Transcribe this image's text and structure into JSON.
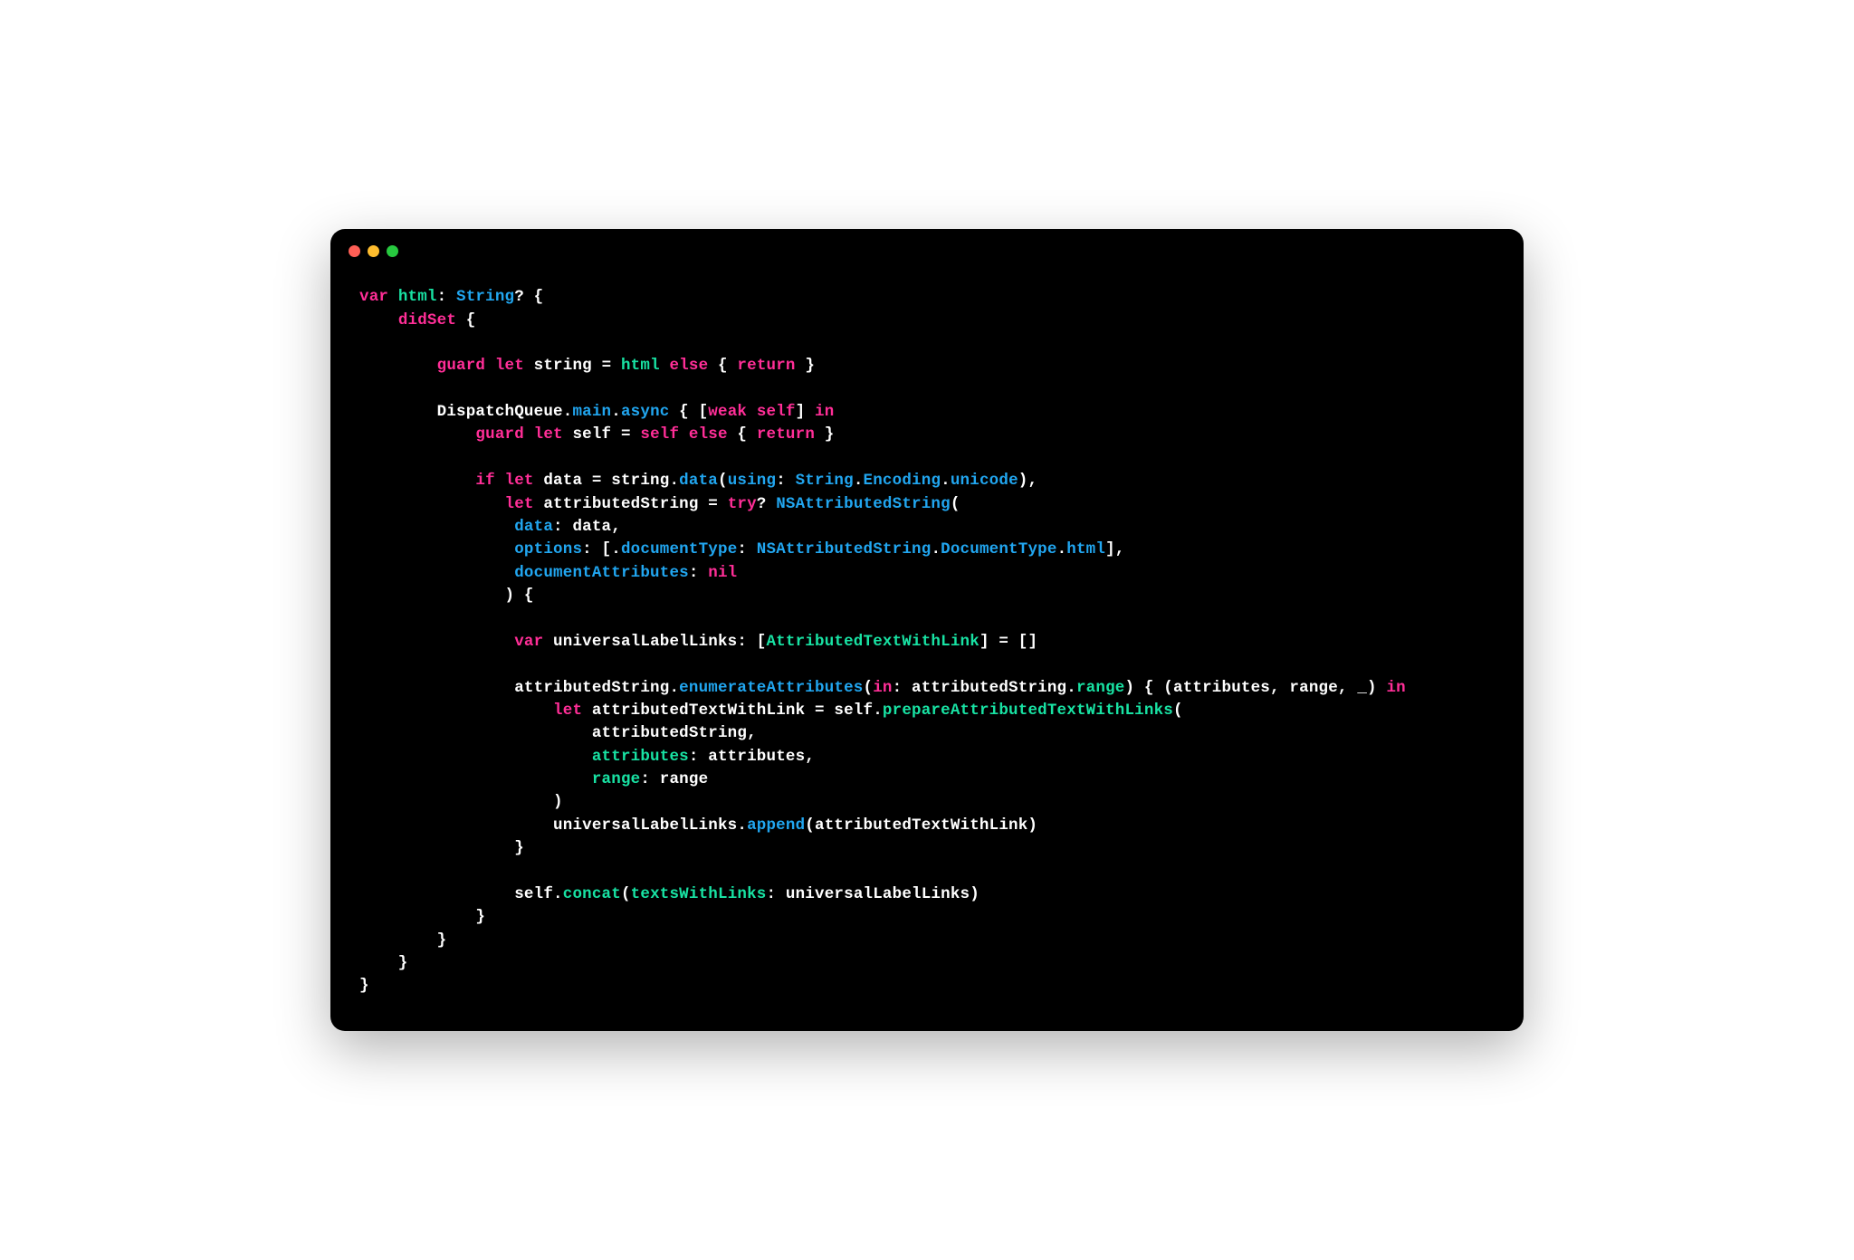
{
  "window": {
    "traffic_lights": [
      "red",
      "yellow",
      "green"
    ]
  },
  "code": {
    "tokens": [
      [
        {
          "t": "var",
          "c": "tok-keyword-pink"
        },
        {
          "t": " ",
          "c": "tok-white"
        },
        {
          "t": "html",
          "c": "tok-method-green"
        },
        {
          "t": ": ",
          "c": "tok-white"
        },
        {
          "t": "String",
          "c": "tok-keyword-blue"
        },
        {
          "t": "? {",
          "c": "tok-white"
        }
      ],
      [
        {
          "t": "    ",
          "c": "tok-white"
        },
        {
          "t": "didSet",
          "c": "tok-keyword-pink"
        },
        {
          "t": " {",
          "c": "tok-white"
        }
      ],
      [
        {
          "t": "",
          "c": "tok-white"
        }
      ],
      [
        {
          "t": "        ",
          "c": "tok-white"
        },
        {
          "t": "guard",
          "c": "tok-keyword-pink"
        },
        {
          "t": " ",
          "c": "tok-white"
        },
        {
          "t": "let",
          "c": "tok-keyword-pink"
        },
        {
          "t": " string = ",
          "c": "tok-white"
        },
        {
          "t": "html",
          "c": "tok-method-green"
        },
        {
          "t": " ",
          "c": "tok-white"
        },
        {
          "t": "else",
          "c": "tok-keyword-pink"
        },
        {
          "t": " { ",
          "c": "tok-white"
        },
        {
          "t": "return",
          "c": "tok-keyword-pink"
        },
        {
          "t": " }",
          "c": "tok-white"
        }
      ],
      [
        {
          "t": "",
          "c": "tok-white"
        }
      ],
      [
        {
          "t": "        DispatchQueue.",
          "c": "tok-white"
        },
        {
          "t": "main",
          "c": "tok-keyword-blue"
        },
        {
          "t": ".",
          "c": "tok-white"
        },
        {
          "t": "async",
          "c": "tok-keyword-blue"
        },
        {
          "t": " { [",
          "c": "tok-white"
        },
        {
          "t": "weak",
          "c": "tok-keyword-pink"
        },
        {
          "t": " ",
          "c": "tok-white"
        },
        {
          "t": "self",
          "c": "tok-keyword-pink"
        },
        {
          "t": "] ",
          "c": "tok-white"
        },
        {
          "t": "in",
          "c": "tok-keyword-pink"
        }
      ],
      [
        {
          "t": "            ",
          "c": "tok-white"
        },
        {
          "t": "guard",
          "c": "tok-keyword-pink"
        },
        {
          "t": " ",
          "c": "tok-white"
        },
        {
          "t": "let",
          "c": "tok-keyword-pink"
        },
        {
          "t": " self = ",
          "c": "tok-white"
        },
        {
          "t": "self",
          "c": "tok-keyword-pink"
        },
        {
          "t": " ",
          "c": "tok-white"
        },
        {
          "t": "else",
          "c": "tok-keyword-pink"
        },
        {
          "t": " { ",
          "c": "tok-white"
        },
        {
          "t": "return",
          "c": "tok-keyword-pink"
        },
        {
          "t": " }",
          "c": "tok-white"
        }
      ],
      [
        {
          "t": "",
          "c": "tok-white"
        }
      ],
      [
        {
          "t": "            ",
          "c": "tok-white"
        },
        {
          "t": "if",
          "c": "tok-keyword-pink"
        },
        {
          "t": " ",
          "c": "tok-white"
        },
        {
          "t": "let",
          "c": "tok-keyword-pink"
        },
        {
          "t": " data = string.",
          "c": "tok-white"
        },
        {
          "t": "data",
          "c": "tok-keyword-blue"
        },
        {
          "t": "(",
          "c": "tok-white"
        },
        {
          "t": "using",
          "c": "tok-keyword-blue"
        },
        {
          "t": ": ",
          "c": "tok-white"
        },
        {
          "t": "String",
          "c": "tok-keyword-blue"
        },
        {
          "t": ".",
          "c": "tok-white"
        },
        {
          "t": "Encoding",
          "c": "tok-keyword-blue"
        },
        {
          "t": ".",
          "c": "tok-white"
        },
        {
          "t": "unicode",
          "c": "tok-keyword-blue"
        },
        {
          "t": "),",
          "c": "tok-white"
        }
      ],
      [
        {
          "t": "               ",
          "c": "tok-white"
        },
        {
          "t": "let",
          "c": "tok-keyword-pink"
        },
        {
          "t": " attributedString = ",
          "c": "tok-white"
        },
        {
          "t": "try",
          "c": "tok-keyword-pink"
        },
        {
          "t": "? ",
          "c": "tok-white"
        },
        {
          "t": "NSAttributedString",
          "c": "tok-keyword-blue"
        },
        {
          "t": "(",
          "c": "tok-white"
        }
      ],
      [
        {
          "t": "                ",
          "c": "tok-white"
        },
        {
          "t": "data",
          "c": "tok-keyword-blue"
        },
        {
          "t": ": data,",
          "c": "tok-white"
        }
      ],
      [
        {
          "t": "                ",
          "c": "tok-white"
        },
        {
          "t": "options",
          "c": "tok-keyword-blue"
        },
        {
          "t": ": [.",
          "c": "tok-white"
        },
        {
          "t": "documentType",
          "c": "tok-keyword-blue"
        },
        {
          "t": ": ",
          "c": "tok-white"
        },
        {
          "t": "NSAttributedString",
          "c": "tok-keyword-blue"
        },
        {
          "t": ".",
          "c": "tok-white"
        },
        {
          "t": "DocumentType",
          "c": "tok-keyword-blue"
        },
        {
          "t": ".",
          "c": "tok-white"
        },
        {
          "t": "html",
          "c": "tok-keyword-blue"
        },
        {
          "t": "],",
          "c": "tok-white"
        }
      ],
      [
        {
          "t": "                ",
          "c": "tok-white"
        },
        {
          "t": "documentAttributes",
          "c": "tok-keyword-blue"
        },
        {
          "t": ": ",
          "c": "tok-white"
        },
        {
          "t": "nil",
          "c": "tok-keyword-pink"
        }
      ],
      [
        {
          "t": "               ) {",
          "c": "tok-white"
        }
      ],
      [
        {
          "t": "",
          "c": "tok-white"
        }
      ],
      [
        {
          "t": "                ",
          "c": "tok-white"
        },
        {
          "t": "var",
          "c": "tok-keyword-pink"
        },
        {
          "t": " universalLabelLinks: [",
          "c": "tok-white"
        },
        {
          "t": "AttributedTextWithLink",
          "c": "tok-method-green"
        },
        {
          "t": "] = []",
          "c": "tok-white"
        }
      ],
      [
        {
          "t": "",
          "c": "tok-white"
        }
      ],
      [
        {
          "t": "                attributedString.",
          "c": "tok-white"
        },
        {
          "t": "enumerateAttributes",
          "c": "tok-keyword-blue"
        },
        {
          "t": "(",
          "c": "tok-white"
        },
        {
          "t": "in",
          "c": "tok-keyword-pink"
        },
        {
          "t": ": attributedString.",
          "c": "tok-white"
        },
        {
          "t": "range",
          "c": "tok-method-green"
        },
        {
          "t": ") { (attributes, range, _) ",
          "c": "tok-white"
        },
        {
          "t": "in",
          "c": "tok-keyword-pink"
        }
      ],
      [
        {
          "t": "                    ",
          "c": "tok-white"
        },
        {
          "t": "let",
          "c": "tok-keyword-pink"
        },
        {
          "t": " attributedTextWithLink = self.",
          "c": "tok-white"
        },
        {
          "t": "prepareAttributedTextWithLinks",
          "c": "tok-method-green"
        },
        {
          "t": "(",
          "c": "tok-white"
        }
      ],
      [
        {
          "t": "                        attributedString,",
          "c": "tok-white"
        }
      ],
      [
        {
          "t": "                        ",
          "c": "tok-white"
        },
        {
          "t": "attributes",
          "c": "tok-method-green"
        },
        {
          "t": ": attributes,",
          "c": "tok-white"
        }
      ],
      [
        {
          "t": "                        ",
          "c": "tok-white"
        },
        {
          "t": "range",
          "c": "tok-method-green"
        },
        {
          "t": ": range",
          "c": "tok-white"
        }
      ],
      [
        {
          "t": "                    )",
          "c": "tok-white"
        }
      ],
      [
        {
          "t": "                    universalLabelLinks.",
          "c": "tok-white"
        },
        {
          "t": "append",
          "c": "tok-keyword-blue"
        },
        {
          "t": "(attributedTextWithLink)",
          "c": "tok-white"
        }
      ],
      [
        {
          "t": "                }",
          "c": "tok-white"
        }
      ],
      [
        {
          "t": "",
          "c": "tok-white"
        }
      ],
      [
        {
          "t": "                self.",
          "c": "tok-white"
        },
        {
          "t": "concat",
          "c": "tok-method-green"
        },
        {
          "t": "(",
          "c": "tok-white"
        },
        {
          "t": "textsWithLinks",
          "c": "tok-method-green"
        },
        {
          "t": ": universalLabelLinks)",
          "c": "tok-white"
        }
      ],
      [
        {
          "t": "            }",
          "c": "tok-white"
        }
      ],
      [
        {
          "t": "        }",
          "c": "tok-white"
        }
      ],
      [
        {
          "t": "    }",
          "c": "tok-white"
        }
      ],
      [
        {
          "t": "}",
          "c": "tok-white"
        }
      ]
    ]
  }
}
